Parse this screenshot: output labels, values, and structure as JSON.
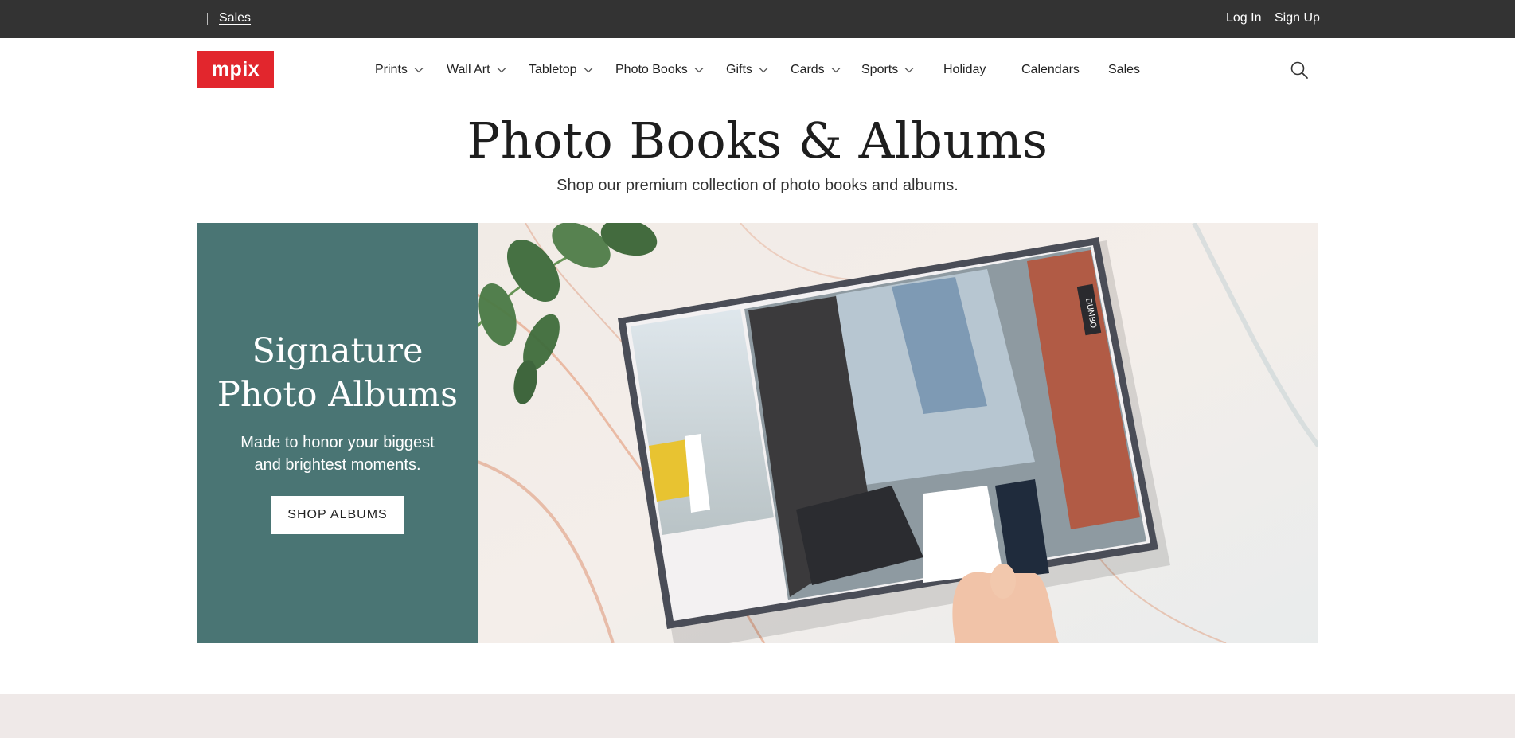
{
  "topbar": {
    "sales_link": "Sales",
    "login": "Log In",
    "signup": "Sign Up"
  },
  "logo": {
    "text": "mpix"
  },
  "nav": {
    "items": [
      {
        "label": "Prints",
        "has_dropdown": true
      },
      {
        "label": "Wall Art",
        "has_dropdown": true
      },
      {
        "label": "Tabletop",
        "has_dropdown": true
      },
      {
        "label": "Photo Books",
        "has_dropdown": true
      },
      {
        "label": "Gifts",
        "has_dropdown": true
      },
      {
        "label": "Cards",
        "has_dropdown": true
      },
      {
        "label": "Sports",
        "has_dropdown": true
      },
      {
        "label": "Holiday",
        "has_dropdown": false
      },
      {
        "label": "Calendars",
        "has_dropdown": false
      },
      {
        "label": "Sales",
        "has_dropdown": false
      }
    ],
    "search_icon": "search-icon"
  },
  "page": {
    "title": "Photo Books & Albums",
    "subtitle": "Shop our premium collection of photo books and albums."
  },
  "hero": {
    "title_line1": "Signature",
    "title_line2": "Photo Albums",
    "text_line1": "Made to honor your biggest",
    "text_line2": "and brightest moments.",
    "button_label": "SHOP ALBUMS",
    "image_sign": "DUMBO"
  },
  "colors": {
    "topbar_bg": "#333333",
    "logo_bg": "#e2262d",
    "hero_panel_bg": "#4a7574",
    "bottom_band": "#efe9e8"
  }
}
